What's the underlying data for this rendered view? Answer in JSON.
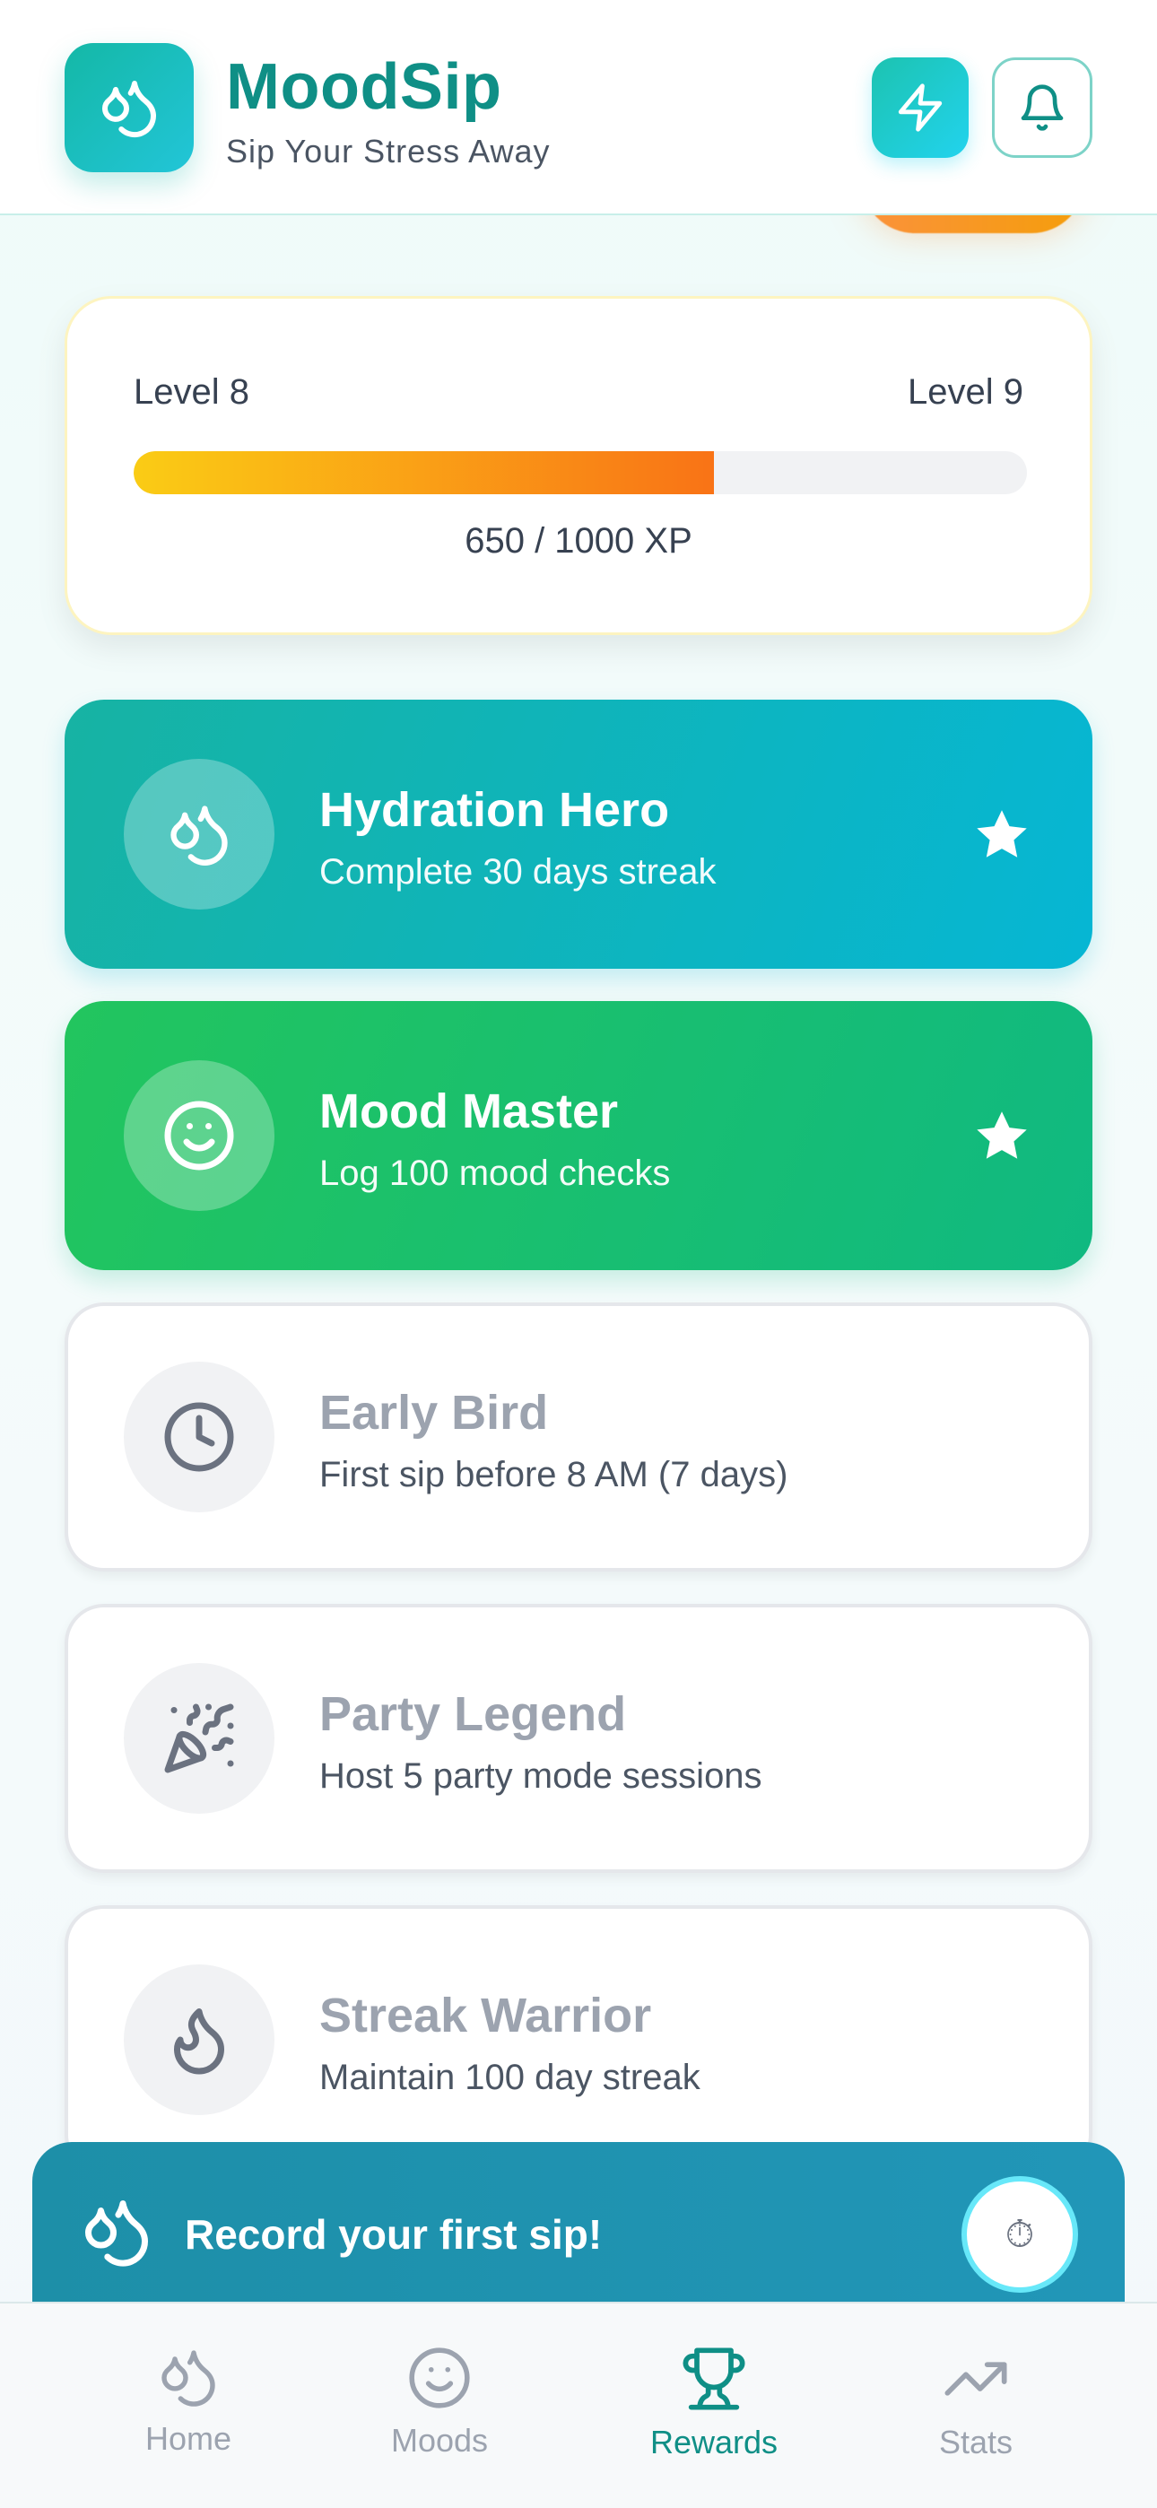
{
  "header": {
    "app_name": "MoodSip",
    "tagline": "Sip Your Stress Away",
    "icons": {
      "app": "drops-icon",
      "quick": "bolt-icon",
      "notifications": "bell-icon"
    }
  },
  "xp": {
    "current_level": "Level 8",
    "next_level": "Level 9",
    "progress_text": "650 / 1000 XP",
    "progress_fraction": 0.65
  },
  "achievements": [
    {
      "title": "Hydration Hero",
      "description": "Complete 30 days streak",
      "icon": "drops-icon",
      "unlocked": true,
      "color": "#14b8a6"
    },
    {
      "title": "Mood Master",
      "description": "Log 100 mood checks",
      "icon": "smiley-icon",
      "unlocked": true,
      "color": "#22c55e"
    },
    {
      "title": "Early Bird",
      "description": "First sip before 8 AM (7 days)",
      "icon": "clock-icon",
      "unlocked": false
    },
    {
      "title": "Party Legend",
      "description": "Host 5 party mode sessions",
      "icon": "party-popper-icon",
      "unlocked": false
    },
    {
      "title": "Streak Warrior",
      "description": "Maintain 100 day streak",
      "icon": "flame-icon",
      "unlocked": false
    }
  ],
  "sip_banner": {
    "text": "Record your first sip!",
    "timer_glyph": "⏱"
  },
  "nav": {
    "items": [
      {
        "label": "Home",
        "icon": "drops-icon"
      },
      {
        "label": "Moods",
        "icon": "smiley-icon"
      },
      {
        "label": "Rewards",
        "icon": "trophy-icon"
      },
      {
        "label": "Stats",
        "icon": "trending-up-icon"
      }
    ],
    "active": "Rewards"
  },
  "colors": {
    "brand_teal": "#0f8f86",
    "accent_cyan": "#06b6d4",
    "xp_start": "#facc15",
    "xp_end": "#f97316",
    "locked_text": "#9ca3af"
  }
}
